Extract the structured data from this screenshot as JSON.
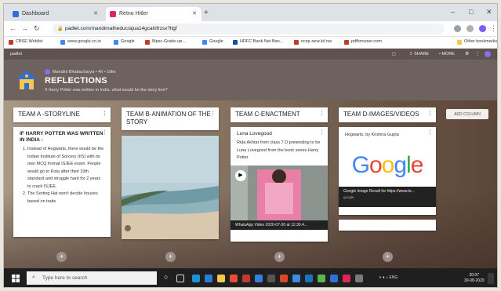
{
  "browser": {
    "tabs": [
      {
        "label": "Dashboard",
        "icon": "dashboard-favicon",
        "color": "#2f6fd6"
      },
      {
        "label": "Retno Hitler",
        "icon": "padlet-favicon",
        "color": "#e0245e"
      }
    ],
    "new_tab": "+",
    "window_controls": [
      "–",
      "□",
      "✕"
    ],
    "url": "padlet.com/mandimatheduc/ajua14gcahifrzsx?ltgf",
    "bookmarks": [
      {
        "label": "CBSE Weblist",
        "color": "#c0392b"
      },
      {
        "label": "www.google.co.in",
        "color": "#4285f4"
      },
      {
        "label": "Google",
        "color": "#4285f4"
      },
      {
        "label": "Mpsc-Grade-up...",
        "color": "#c0392b"
      },
      {
        "label": "Google",
        "color": "#4285f4"
      },
      {
        "label": "HDFC Bank Net Ban...",
        "color": "#1a4fa0"
      },
      {
        "label": "ncsp-new.lol.nw",
        "color": "#c0392b"
      },
      {
        "label": "pdfbrowser.com",
        "color": "#c0392b"
      }
    ],
    "other_bookmarks": "Other bookmarks"
  },
  "padlet": {
    "topbar_left": "padlet",
    "topbar_right": [
      "⇪ SHARE",
      "• MORE"
    ],
    "author": "Mandini Bhattacharya • 4h • 1like",
    "title": "REFLECTIONS",
    "subtitle": "If Harry Potter was written in India, what would be the story line?",
    "add_column": "ADD COLUMN",
    "columns": [
      {
        "header": "TEAM A -STORYLINE",
        "card_title": "IF HARRY POTTER WAS WRITTEN IN INDIA :",
        "items": [
          "Instead of Hogwarts, there would be the Indian Institute of Sorcery (IIS) with its own MCQ format ISJEE exam. People would go to Kota after their 10th standard and struggle hard for 2 years to crack ISJEE.",
          "The Sorting Hat won't decide houses based on traits"
        ]
      },
      {
        "header": "TEAM B-ANIMATION OF THE STORY"
      },
      {
        "header": "TEAM C-ENACTMENT",
        "card_title": "Luna Lovegood",
        "card_body": "Rida Akhtar from class 7 D pretending to be Luna Lovegood from the book series Harry Potter",
        "video_caption": "WhatsApp Video 2020-07-30 at 12.30.4..."
      },
      {
        "header": "TEAM D-IMAGES/VIDEOS",
        "card_meta": "Hogwarts, by Krishna Gupta",
        "google_text": "Google",
        "link_title": "Google Image Result for https://www.te...",
        "link_source": "google"
      }
    ]
  },
  "taskbar": {
    "search_placeholder": "Type here to search",
    "tray": "∧ ♦ ⌂ ENG",
    "time": "20:07",
    "date": "30-08-2020"
  },
  "colors": {
    "padlet_bg": "#6e625f",
    "taskbar_bg": "#1f1f1f",
    "google_blue": "#4285f4",
    "google_red": "#ea4335",
    "google_yellow": "#fbbc05",
    "google_green": "#34a853"
  }
}
